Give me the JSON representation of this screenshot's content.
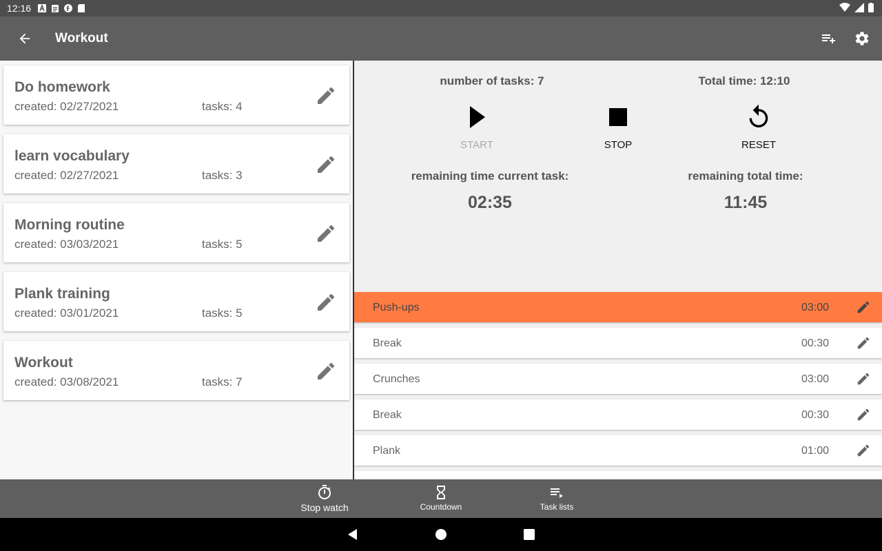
{
  "status_bar": {
    "time": "12:16"
  },
  "app_bar": {
    "title": "Workout"
  },
  "task_lists": [
    {
      "name": "Do homework",
      "created": "created: 02/27/2021",
      "tasks": "tasks: 4"
    },
    {
      "name": "learn vocabulary",
      "created": "created: 02/27/2021",
      "tasks": "tasks: 3"
    },
    {
      "name": "Morning routine",
      "created": "created: 03/03/2021",
      "tasks": "tasks: 5"
    },
    {
      "name": "Plank training",
      "created": "created: 03/01/2021",
      "tasks": "tasks: 5"
    },
    {
      "name": "Workout",
      "created": "created: 03/08/2021",
      "tasks": "tasks: 7"
    }
  ],
  "timer": {
    "number_of_tasks": "number of tasks: 7",
    "total_time": "Total time: 12:10",
    "start_label": "START",
    "stop_label": "STOP",
    "reset_label": "RESET",
    "remaining_current_label": "remaining time current task:",
    "remaining_total_label": "remaining total time:",
    "remaining_current_value": "02:35",
    "remaining_total_value": "11:45"
  },
  "tasks": [
    {
      "name": "Push-ups",
      "time": "03:00",
      "active": true
    },
    {
      "name": "Break",
      "time": "00:30",
      "active": false
    },
    {
      "name": "Crunches",
      "time": "03:00",
      "active": false
    },
    {
      "name": "Break",
      "time": "00:30",
      "active": false
    },
    {
      "name": "Plank",
      "time": "01:00",
      "active": false
    }
  ],
  "bottom_nav": {
    "stopwatch": "Stop watch",
    "countdown": "Countdown",
    "task_lists": "Task lists"
  },
  "colors": {
    "active_task": "#ff7b42",
    "app_bar": "#5f5f5f",
    "status_bar": "#4d4d4d"
  }
}
